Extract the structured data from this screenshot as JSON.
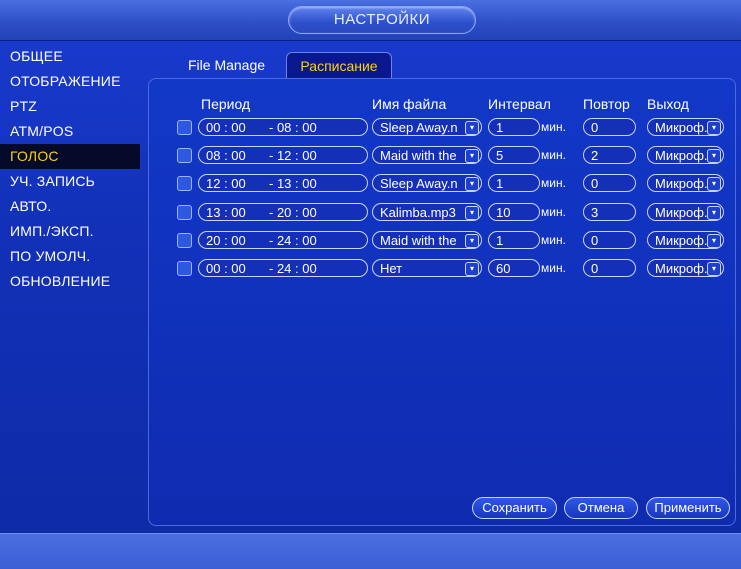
{
  "window": {
    "title": "НАСТРОЙКИ"
  },
  "nav": {
    "items": [
      {
        "label": "ОБЩЕЕ"
      },
      {
        "label": "ОТОБРАЖЕНИЕ"
      },
      {
        "label": "PTZ"
      },
      {
        "label": "ATM/POS"
      },
      {
        "label": "ГОЛОС",
        "active": true
      },
      {
        "label": "УЧ. ЗАПИСЬ"
      },
      {
        "label": "АВТО."
      },
      {
        "label": "ИМП./ЭКСП."
      },
      {
        "label": "ПО УМОЛЧ."
      },
      {
        "label": "ОБНОВЛЕНИЕ"
      }
    ]
  },
  "tabs": [
    {
      "label": "File Manage",
      "active": false
    },
    {
      "label": "Расписание",
      "active": true
    }
  ],
  "table": {
    "headers": {
      "period": "Период",
      "file": "Имя файла",
      "interval": "Интервал",
      "repeat": "Повтор",
      "output": "Выход"
    },
    "unit": "мин.",
    "rows": [
      {
        "start": "00 : 00",
        "end": "08 : 00",
        "file": "Sleep Away.n",
        "interval": "1",
        "repeat": "0",
        "output": "Микроф."
      },
      {
        "start": "08 : 00",
        "end": "12 : 00",
        "file": "Maid with the",
        "interval": "5",
        "repeat": "2",
        "output": "Микроф."
      },
      {
        "start": "12 : 00",
        "end": "13 : 00",
        "file": "Sleep Away.n",
        "interval": "1",
        "repeat": "0",
        "output": "Микроф."
      },
      {
        "start": "13 : 00",
        "end": "20 : 00",
        "file": "Kalimba.mp3",
        "interval": "10",
        "repeat": "3",
        "output": "Микроф."
      },
      {
        "start": "20 : 00",
        "end": "24 : 00",
        "file": "Maid with the",
        "interval": "1",
        "repeat": "0",
        "output": "Микроф."
      },
      {
        "start": "00 : 00",
        "end": "24 : 00",
        "file": "Нет",
        "interval": "60",
        "repeat": "0",
        "output": "Микроф."
      }
    ]
  },
  "buttons": {
    "save": "Сохранить",
    "cancel": "Отмена",
    "apply": "Применить"
  },
  "colors": {
    "accent": "#ffd200",
    "background": "#1231b8"
  }
}
